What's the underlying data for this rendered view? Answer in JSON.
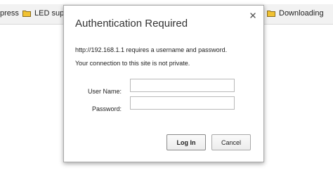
{
  "bookmarks_bar": {
    "items": [
      {
        "label": "press",
        "icon": "none"
      },
      {
        "label": "LED suppl",
        "icon": "folder-icon"
      },
      {
        "label": "Downloading",
        "icon": "folder-icon"
      }
    ],
    "folder_color": "#f1c232"
  },
  "dialog": {
    "title": "Authentication Required",
    "close_glyph": "×",
    "message_line1": "http://192.168.1.1 requires a username and password.",
    "message_line2": "Your connection to this site is not private.",
    "username_label": "User Name:",
    "username_value": "",
    "password_label": "Password:",
    "password_value": "",
    "login_label": "Log In",
    "cancel_label": "Cancel"
  }
}
